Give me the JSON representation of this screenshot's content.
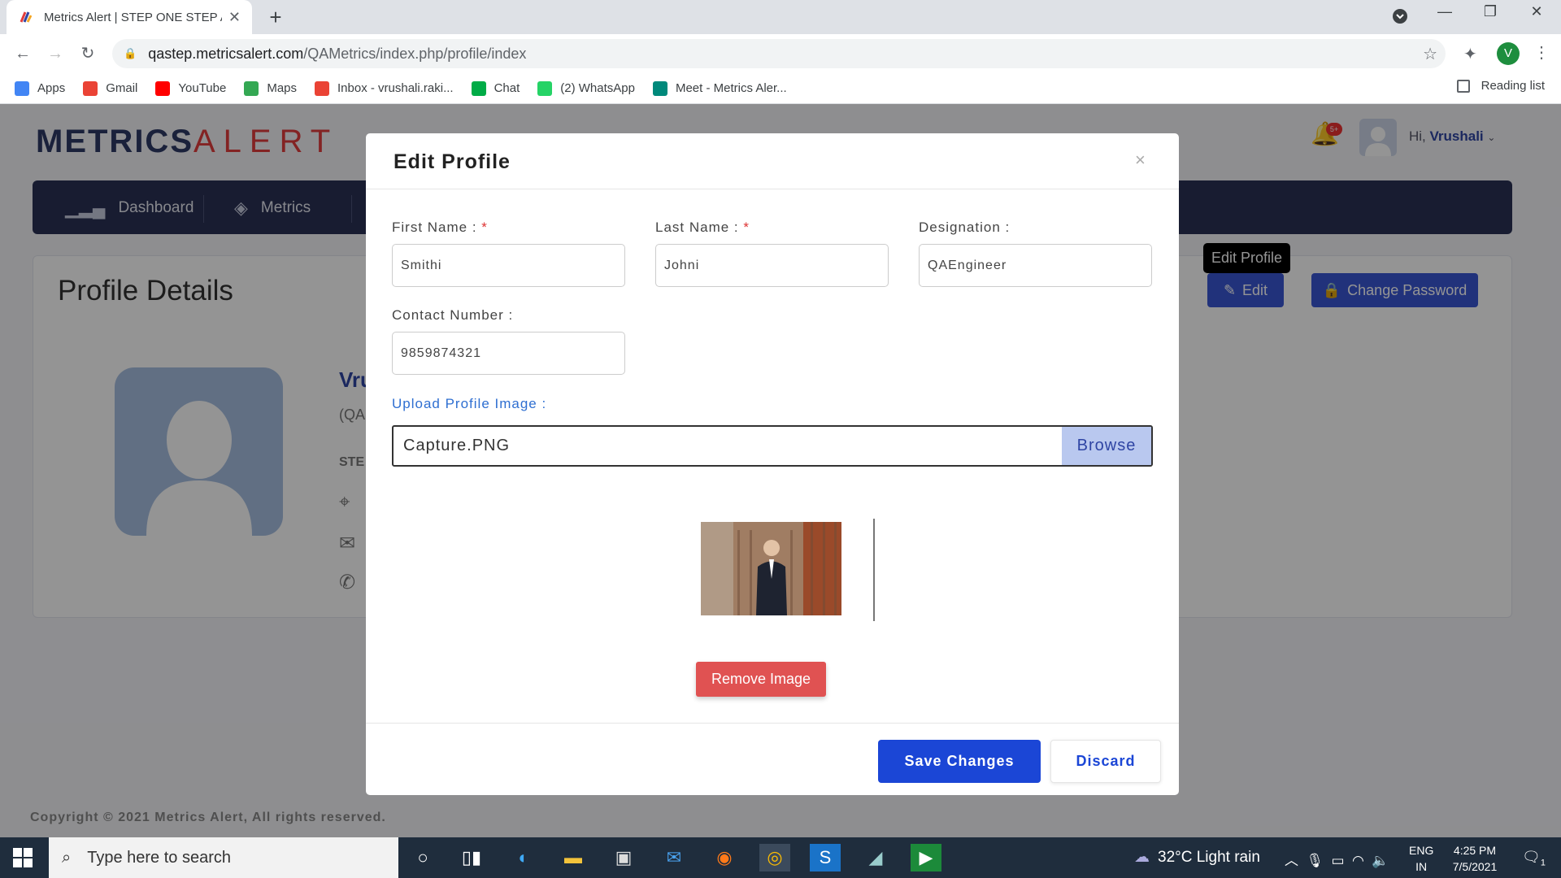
{
  "browser": {
    "tab_title": "Metrics Alert | STEP ONE STEP AHEAD",
    "url_domain": "qastep.metricsalert.com",
    "url_path": "/QAMetrics/index.php/profile/index",
    "profile_initial": "V",
    "bookmarks": [
      {
        "label": "Apps",
        "color": "#4285f4"
      },
      {
        "label": "Gmail",
        "color": "#ea4335"
      },
      {
        "label": "YouTube",
        "color": "#ff0000"
      },
      {
        "label": "Maps",
        "color": "#34a853"
      },
      {
        "label": "Inbox - vrushali.raki...",
        "color": "#ea4335"
      },
      {
        "label": "Chat",
        "color": "#00ac47"
      },
      {
        "label": "(2) WhatsApp",
        "color": "#25d366"
      },
      {
        "label": "Meet - Metrics Aler...",
        "color": "#00897b"
      }
    ],
    "reading_list": "Reading list"
  },
  "app": {
    "logo_metrics": "METRICS",
    "logo_alert": "ALERT",
    "notif_badge": "5+",
    "greeting": "Hi, ",
    "user_name": "Vrushali",
    "nav": [
      "Dashboard",
      "Metrics"
    ],
    "page_title": "Profile Details",
    "profile_name": "Vru",
    "profile_designation": "(QA",
    "profile_section": "STE",
    "tooltip": "Edit Profile",
    "edit_label": "Edit",
    "change_password_label": "Change Password",
    "copyright": "Copyright © 2021 Metrics Alert, All rights reserved."
  },
  "modal": {
    "title": "Edit Profile",
    "close": "×",
    "first_name_label": "First Name : ",
    "last_name_label": "Last Name : ",
    "designation_label": "Designation :",
    "contact_label": "Contact Number :",
    "required_mark": "*",
    "first_name": "Smithi",
    "last_name": "Johni",
    "designation": "QAEngineer",
    "contact": "9859874321",
    "upload_label": "Upload Profile Image :",
    "file_name": "Capture.PNG",
    "browse_label": "Browse",
    "remove_label": "Remove Image",
    "save_label": "Save Changes",
    "discard_label": "Discard"
  },
  "taskbar": {
    "search_placeholder": "Type here to search",
    "weather": "32°C  Light rain",
    "lang_line1": "ENG",
    "lang_line2": "IN",
    "time": "4:25 PM",
    "date": "7/5/2021",
    "notif_count": "1"
  }
}
